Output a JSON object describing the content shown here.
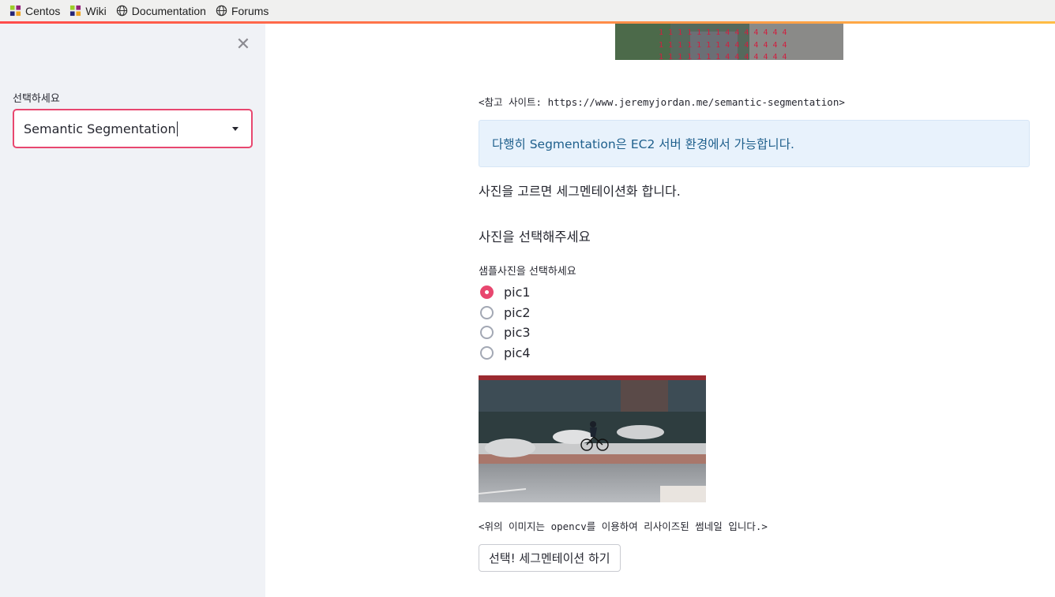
{
  "bookmarks": [
    {
      "label": "Centos",
      "icon": "centos-icon"
    },
    {
      "label": "Wiki",
      "icon": "centos-icon"
    },
    {
      "label": "Documentation",
      "icon": "globe-icon"
    },
    {
      "label": "Forums",
      "icon": "globe-icon"
    }
  ],
  "sidebar": {
    "close_icon": "close-icon",
    "select_label": "선택하세요",
    "select_value": "Semantic Segmentation"
  },
  "main": {
    "top_image_digits": "1 1 1 1 1 1 1 4 4 4 4 4 4 4",
    "reference": "<참고 사이트: https://www.jeremyjordan.me/semantic-segmentation>",
    "info_text": "다행히 Segmentation은 EC2 서버 환경에서 가능합니다.",
    "paragraph": "사진을 고르면 세그멘테이션화 합니다.",
    "subheader": "사진을 선택해주세요",
    "radio_label": "샘플사진을 선택하세요",
    "radio_options": [
      "pic1",
      "pic2",
      "pic3",
      "pic4"
    ],
    "radio_selected": "pic1",
    "caption": "<위의 이미지는 opencv를 이용하여 리사이즈된 썸네일 입니다.>",
    "button_label": "선택! 세그멘테이션 하기"
  },
  "colors": {
    "accent": "#e8476f",
    "sidebar_bg": "#f0f2f6",
    "info_bg": "#e8f2fc",
    "info_text": "#1e5f8c"
  }
}
